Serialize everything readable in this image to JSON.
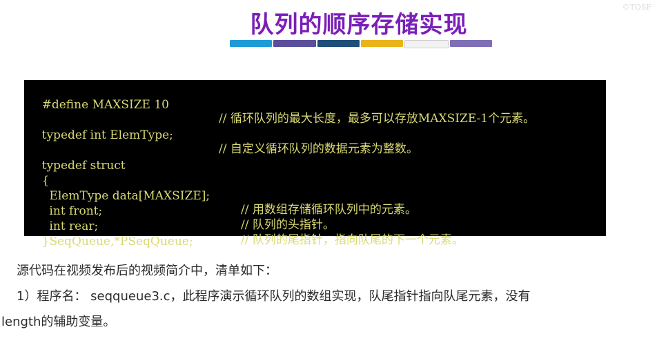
{
  "slide": {
    "title": "队列的顺序存储实现",
    "underline_colors": [
      "#1e9bd7",
      "#5a4f9a",
      "#1f4e79",
      "#e8b41a",
      "#f2f2f2",
      "#7f6fb6"
    ],
    "watermark": "©TOSF"
  },
  "code": {
    "lines": [
      {
        "code": "#define MAXSIZE 10",
        "comment": "// 循环队列的最大长度，最多可以存放MAXSIZE-1个元素。"
      },
      {
        "code": "typedef int ElemType;",
        "comment": "// 自定义循环队列的数据元素为整数。"
      },
      {
        "code": "typedef struct",
        "comment": ""
      },
      {
        "code": "{",
        "comment": ""
      },
      {
        "code": "  ElemType data[MAXSIZE];",
        "comment": "// 用数组存储循环队列中的元素。"
      },
      {
        "code": "  int front;",
        "comment": "// 队列的头指针。"
      },
      {
        "code": "  int rear;",
        "comment": "// 队列的尾指针，指向队尾的下一个元素。"
      },
      {
        "code": "}SeqQueue,*PSeqQueue;",
        "comment": ""
      }
    ]
  },
  "description": {
    "line1": "源代码在视频发布后的视频简介中，清单如下：",
    "line2": "1）程序名： seqqueue3.c，此程序演示循环队列的数组实现，队尾指针指向队尾元素，没有",
    "line3": "length的辅助变量。"
  }
}
